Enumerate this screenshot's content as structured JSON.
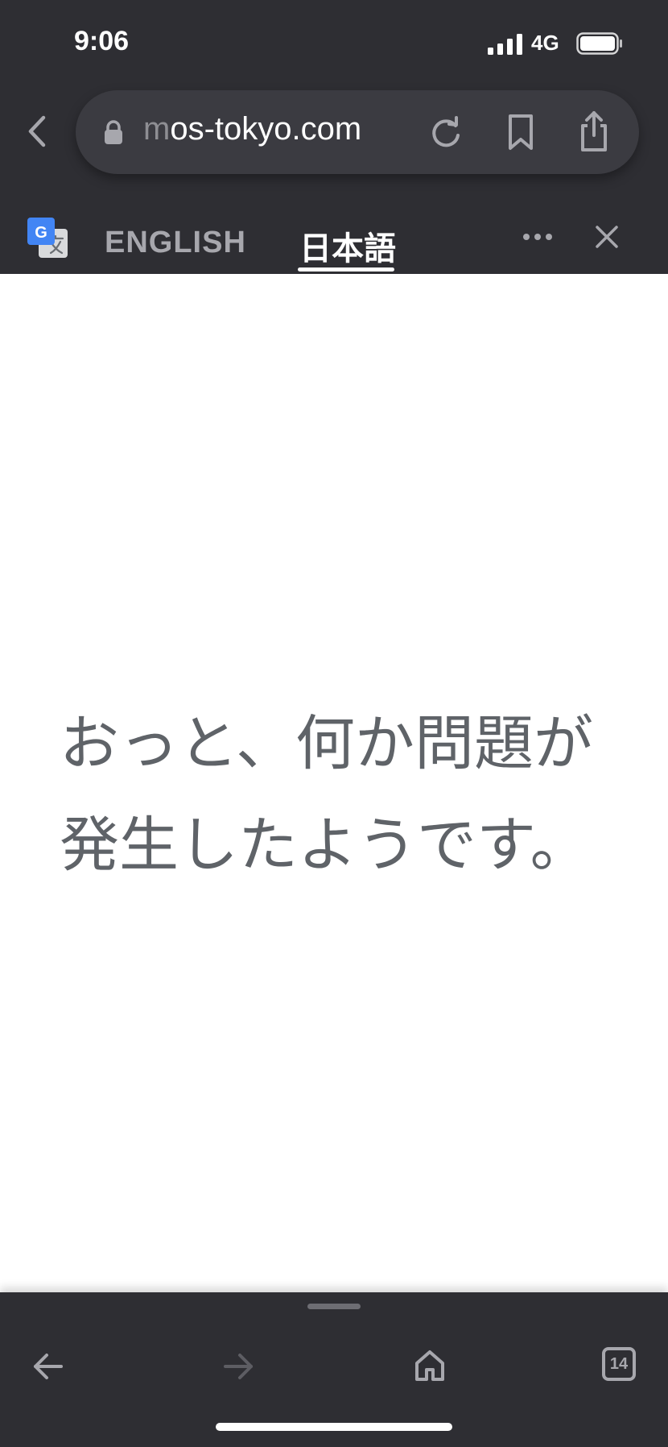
{
  "status_bar": {
    "time": "9:06",
    "network": "4G"
  },
  "browser": {
    "url_faded_prefix": "m",
    "url_text": "os-tokyo.com"
  },
  "translate_bar": {
    "languages": [
      "ENGLISH",
      "日本語"
    ],
    "selected_language": "日本語"
  },
  "page": {
    "error_line_1": "おっと、何か問題が",
    "error_line_2": "発生したようです。"
  },
  "bottom_toolbar": {
    "tab_count": "14"
  },
  "colors": {
    "chrome_background": "#2e2e33",
    "url_pill": "#3b3b41",
    "message_text": "#5f6368",
    "inactive_icon": "#a7a7ad"
  }
}
